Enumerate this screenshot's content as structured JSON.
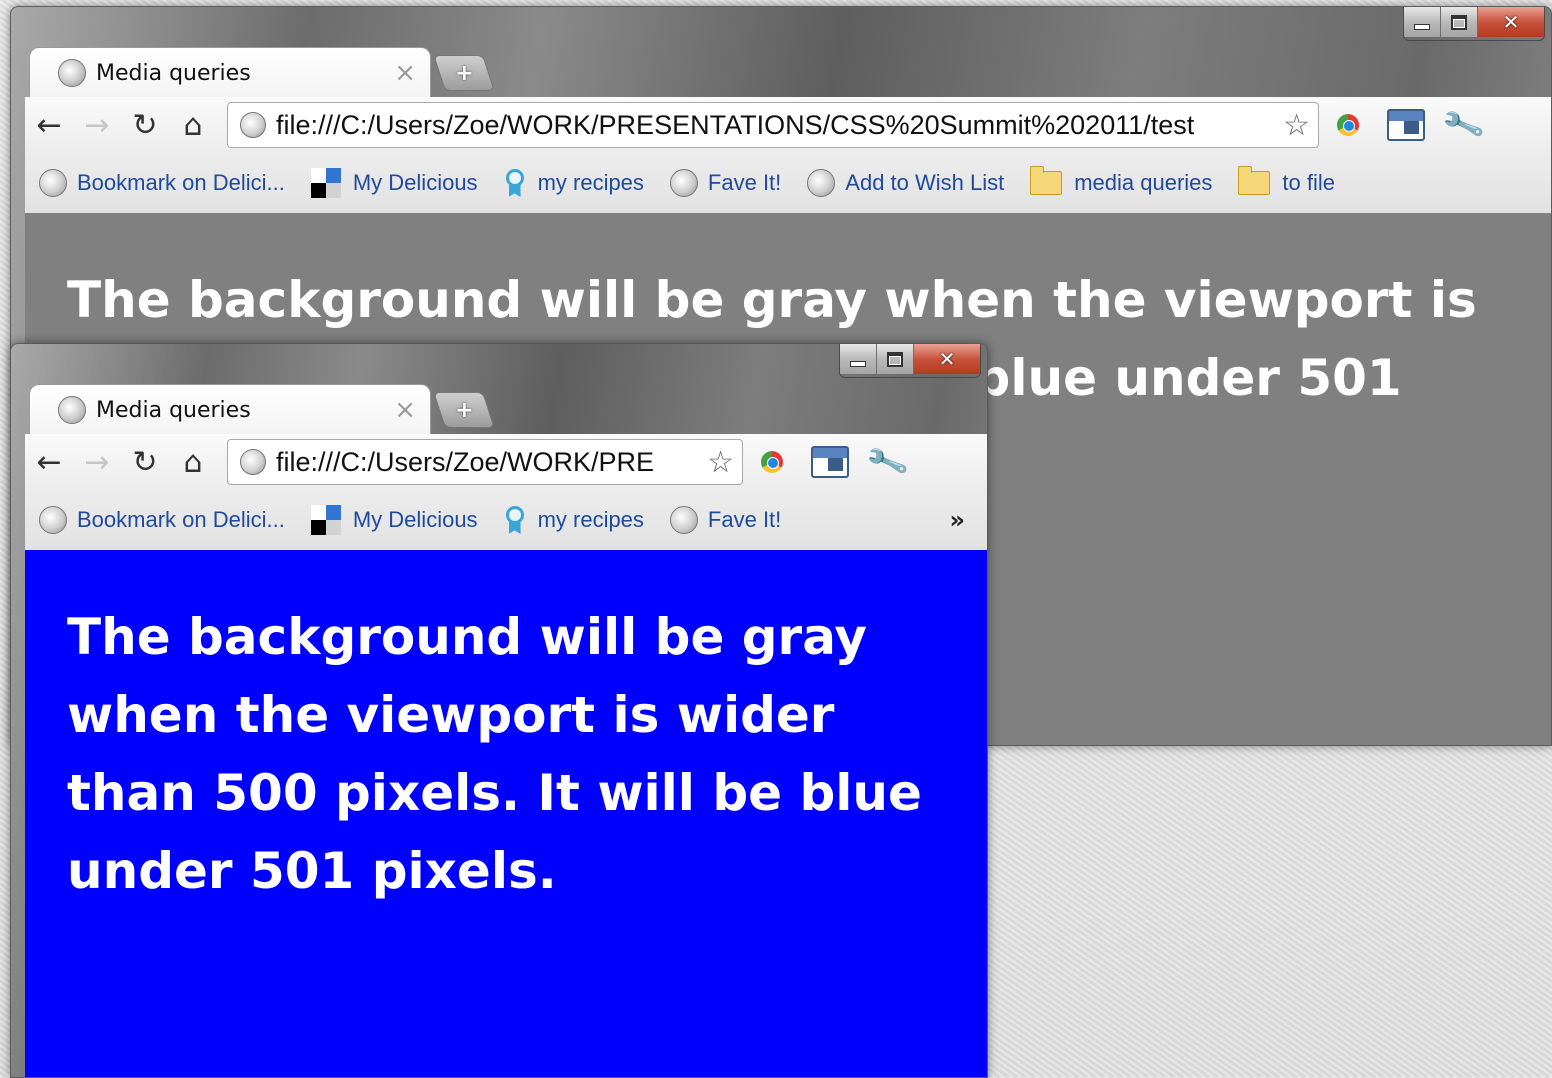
{
  "windows": {
    "large": {
      "tab_title": "Media queries",
      "new_tab_label": "+",
      "url": "file:///C:/Users/Zoe/WORK/PRESENTATIONS/CSS%20Summit%202011/test",
      "bookmarks": [
        {
          "label": "Bookmark on Delici...",
          "icon": "globe-icon"
        },
        {
          "label": "My Delicious",
          "icon": "delicious-icon"
        },
        {
          "label": "my recipes",
          "icon": "ribbon-icon"
        },
        {
          "label": "Fave It!",
          "icon": "globe-icon"
        },
        {
          "label": "Add to Wish List",
          "icon": "globe-icon"
        },
        {
          "label": "media queries",
          "icon": "folder-icon"
        },
        {
          "label": "to file",
          "icon": "folder-icon"
        }
      ],
      "content_text": "The background will be gray when the viewport is wider than 500 pixels. It will be blue under 501 pixels.",
      "content_background": "#808080"
    },
    "small": {
      "tab_title": "Media queries",
      "new_tab_label": "+",
      "url": "file:///C:/Users/Zoe/WORK/PRE",
      "bookmarks": [
        {
          "label": "Bookmark on Delici...",
          "icon": "globe-icon"
        },
        {
          "label": "My Delicious",
          "icon": "delicious-icon"
        },
        {
          "label": "my recipes",
          "icon": "ribbon-icon"
        },
        {
          "label": "Fave It!",
          "icon": "globe-icon"
        }
      ],
      "overflow_chevron": "»",
      "content_text": "The background will be gray when the viewport is wider than 500 pixels. It will be blue under 501 pixels.",
      "content_background": "#0000ff"
    }
  },
  "icons": {
    "back": "←",
    "forward": "→",
    "reload": "↻",
    "home": "⌂",
    "star": "☆",
    "wrench": "🔧",
    "close_tab": "×",
    "close_window": "✕"
  }
}
